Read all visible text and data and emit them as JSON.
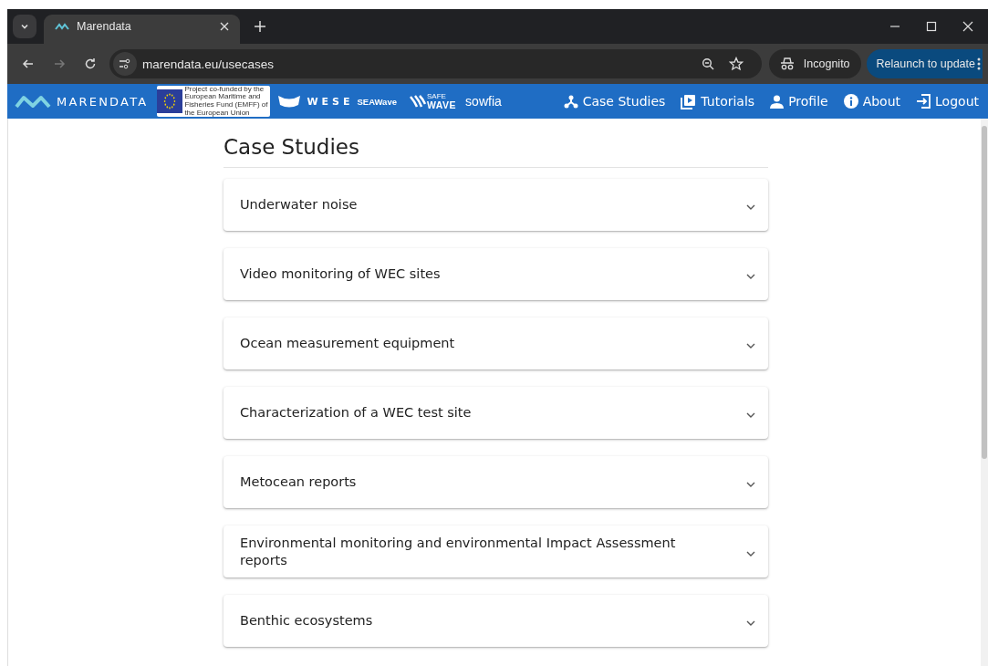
{
  "browser": {
    "tab_title": "Marendata",
    "url": "marendata.eu/usecases",
    "incognito_label": "Incognito",
    "relaunch_label": "Relaunch to update"
  },
  "navbar": {
    "brand": "MARENDATA",
    "eu_notice": "Project co-funded by the European Maritime and Fisheries Fund (EMFF) of the European Union",
    "partner_logos": [
      {
        "kind": "wese",
        "text": "WESE"
      },
      {
        "kind": "seawave",
        "text": "SEAWave"
      },
      {
        "kind": "safewave",
        "small": "SAFE",
        "text": "WAVE"
      },
      {
        "kind": "sowfia",
        "text": "sowfia"
      }
    ],
    "links": [
      {
        "kind": "cases",
        "label": "Case Studies"
      },
      {
        "kind": "tutorials",
        "label": "Tutorials"
      },
      {
        "kind": "profile",
        "label": "Profile"
      },
      {
        "kind": "about",
        "label": "About"
      },
      {
        "kind": "logout",
        "label": "Logout"
      }
    ]
  },
  "page": {
    "title": "Case Studies",
    "cases": [
      {
        "title": "Underwater noise",
        "expanded": false
      },
      {
        "title": "Video monitoring of WEC sites",
        "expanded": false
      },
      {
        "title": "Ocean measurement equipment",
        "expanded": false
      },
      {
        "title": "Characterization of a WEC test site",
        "expanded": false
      },
      {
        "title": "Metocean reports",
        "expanded": false
      },
      {
        "title": "Environmental monitoring and environmental Impact Assessment reports",
        "expanded": false
      },
      {
        "title": "Benthic ecosystems",
        "expanded": false
      }
    ]
  }
}
